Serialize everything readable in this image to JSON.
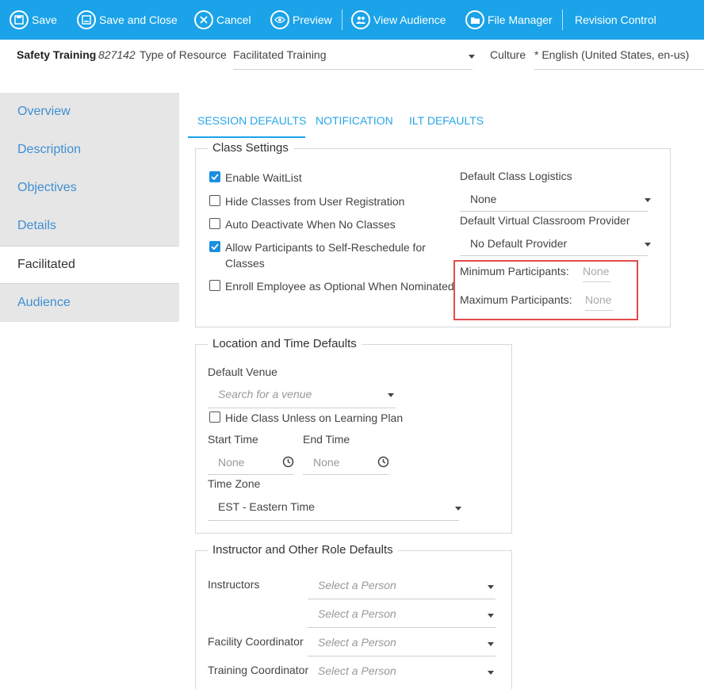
{
  "toolbar": {
    "save": "Save",
    "save_close": "Save and Close",
    "cancel": "Cancel",
    "preview": "Preview",
    "view_audience": "View Audience",
    "file_manager": "File Manager",
    "revision_control": "Revision Control",
    "bg_color": "#1aa3e8"
  },
  "header": {
    "title": "Safety Training",
    "id": "827142",
    "type_label": "Type of Resource",
    "type_value": "Facilitated Training",
    "culture_label": "Culture",
    "culture_value": "* English (United States, en-us)"
  },
  "nav": {
    "items": [
      {
        "label": "Overview"
      },
      {
        "label": "Description"
      },
      {
        "label": "Objectives"
      },
      {
        "label": "Details"
      },
      {
        "label": "Facilitated"
      },
      {
        "label": "Audience"
      }
    ],
    "active": "Facilitated"
  },
  "tabs": [
    {
      "label": "SESSION DEFAULTS"
    },
    {
      "label": "NOTIFICATION"
    },
    {
      "label": "ILT DEFAULTS"
    }
  ],
  "class_settings": {
    "legend": "Class Settings",
    "checkboxes": [
      {
        "label": "Enable WaitList",
        "checked": true
      },
      {
        "label": "Hide Classes from User Registration",
        "checked": false
      },
      {
        "label": "Auto Deactivate When No Classes",
        "checked": false
      },
      {
        "label": "Allow Participants to Self-Reschedule for Classes",
        "checked": true
      },
      {
        "label": "Enroll Employee as Optional When Nominated",
        "checked": false
      }
    ],
    "logistics_label": "Default Class Logistics",
    "logistics_value": "None",
    "provider_label": "Default Virtual Classroom Provider",
    "provider_value": "No Default Provider",
    "min_label": "Minimum Participants:",
    "min_value": "None",
    "max_label": "Maximum Participants:",
    "max_value": "None"
  },
  "location": {
    "legend": "Location and Time Defaults",
    "venue_label": "Default Venue",
    "venue_placeholder": "Search for a venue",
    "hide_class_label": "Hide Class Unless on Learning Plan",
    "start_label": "Start Time",
    "start_value": "None",
    "end_label": "End Time",
    "end_value": "None",
    "tz_label": "Time Zone",
    "tz_value": "EST - Eastern Time"
  },
  "roles": {
    "legend": "Instructor and Other Role Defaults",
    "instructors_label": "Instructors",
    "facility_label": "Facility Coordinator",
    "training_label": "Training Coordinator",
    "placeholder": "Select a Person"
  }
}
